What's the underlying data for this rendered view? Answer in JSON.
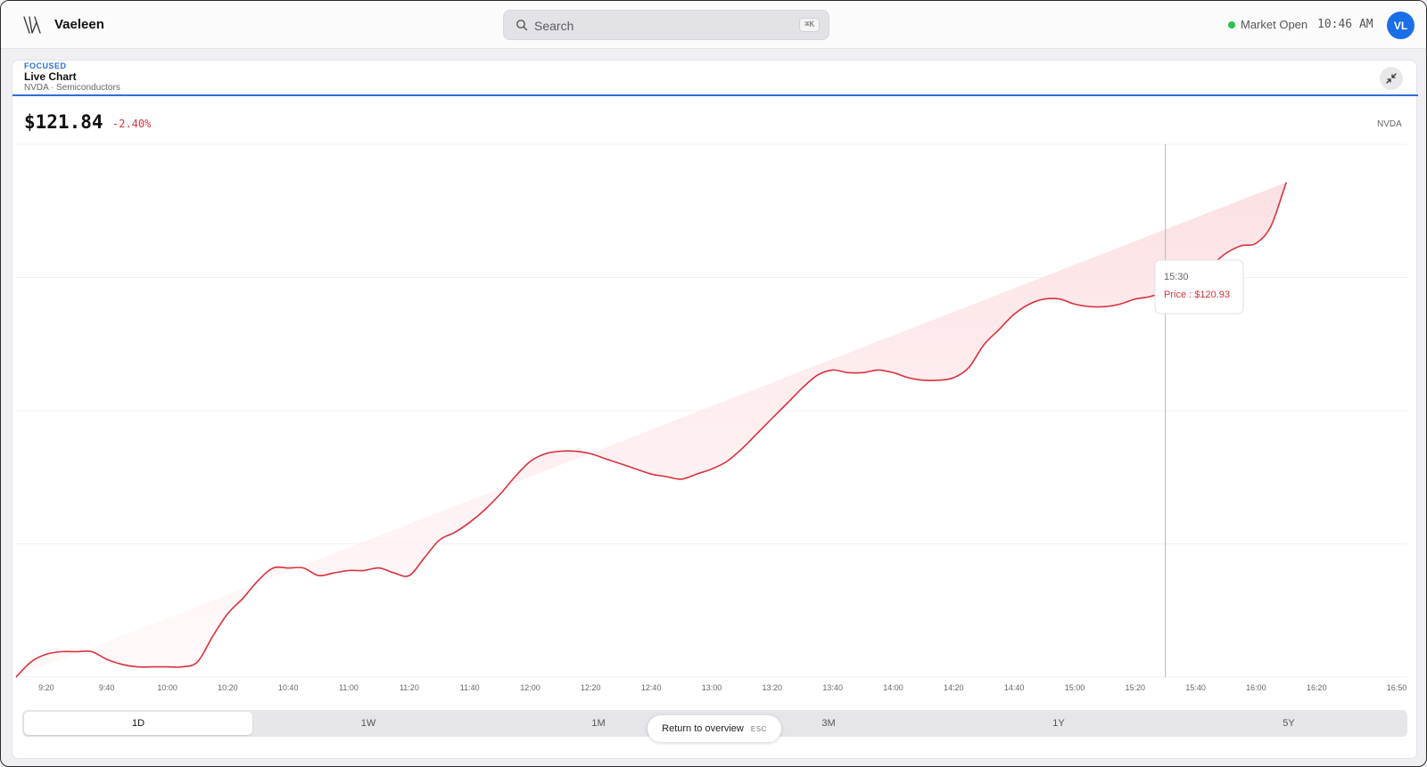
{
  "app": {
    "brand": "Vaeleen",
    "search_placeholder": "Search",
    "search_shortcut": "⌘K",
    "market_status": "Market Open",
    "time": "10:46 AM",
    "user_initials": "VL",
    "colors": {
      "accent": "#2f6fd6",
      "down": "#d8323d",
      "market_open": "#2ac24a",
      "avatar": "#1a6fe8"
    }
  },
  "card": {
    "badge": "FOCUSED",
    "title": "Live Chart",
    "subtitle": "NVDA · Semiconductors",
    "price": "$121.84",
    "change": "-2.40%",
    "ticker": "NVDA"
  },
  "tooltip": {
    "time": "15:30",
    "label": "Price : $120.93"
  },
  "ranges": [
    {
      "label": "1D",
      "active": true
    },
    {
      "label": "1W",
      "active": false
    },
    {
      "label": "1M",
      "active": false
    },
    {
      "label": "3M",
      "active": false
    },
    {
      "label": "1Y",
      "active": false
    },
    {
      "label": "5Y",
      "active": false
    }
  ],
  "return_overview": {
    "label": "Return to overview",
    "key": "ESC"
  },
  "chart_data": {
    "type": "area",
    "x": [
      "9:10",
      "9:15",
      "9:20",
      "9:25",
      "9:30",
      "9:35",
      "9:40",
      "9:45",
      "9:50",
      "9:55",
      "10:00",
      "10:05",
      "10:10",
      "10:15",
      "10:20",
      "10:25",
      "10:30",
      "10:35",
      "10:40",
      "10:45",
      "10:50",
      "10:55",
      "11:00",
      "11:05",
      "11:10",
      "11:15",
      "11:20",
      "11:25",
      "11:30",
      "11:35",
      "11:40",
      "11:45",
      "11:50",
      "11:55",
      "12:00",
      "12:05",
      "12:10",
      "12:15",
      "12:20",
      "12:25",
      "12:30",
      "12:35",
      "12:40",
      "12:45",
      "12:50",
      "12:55",
      "13:00",
      "13:05",
      "13:10",
      "13:15",
      "13:20",
      "13:25",
      "13:30",
      "13:35",
      "13:40",
      "13:45",
      "13:50",
      "13:55",
      "14:00",
      "14:05",
      "14:10",
      "14:15",
      "14:20",
      "14:25",
      "14:30",
      "14:35",
      "14:40",
      "14:45",
      "14:50",
      "14:55",
      "15:00",
      "15:05",
      "15:10",
      "15:15",
      "15:20",
      "15:25",
      "15:30",
      "15:35",
      "15:40",
      "15:45",
      "15:50",
      "15:55",
      "16:00",
      "16:05",
      "16:10",
      "16:15",
      "16:20",
      "16:25",
      "16:30",
      "16:35",
      "16:40",
      "16:45",
      "16:50"
    ],
    "values": [
      106.3,
      106.9,
      107.2,
      107.3,
      107.3,
      107.3,
      107.0,
      106.8,
      106.7,
      106.7,
      106.7,
      106.7,
      106.9,
      107.9,
      108.8,
      109.4,
      110.1,
      110.6,
      110.6,
      110.6,
      110.3,
      110.4,
      110.5,
      110.5,
      110.6,
      110.4,
      110.3,
      111.0,
      111.7,
      112.0,
      112.4,
      112.9,
      113.5,
      114.2,
      114.8,
      115.1,
      115.2,
      115.2,
      115.1,
      114.9,
      114.7,
      114.5,
      114.3,
      114.2,
      114.1,
      114.3,
      114.5,
      114.8,
      115.3,
      115.9,
      116.5,
      117.1,
      117.7,
      118.2,
      118.4,
      118.3,
      118.3,
      118.4,
      118.3,
      118.1,
      118.0,
      118.0,
      118.1,
      118.5,
      119.4,
      120.0,
      120.6,
      121.0,
      121.2,
      121.2,
      121.0,
      120.9,
      120.9,
      121.0,
      121.2,
      121.3,
      121.5,
      121.7,
      122.0,
      122.5,
      123.0,
      123.3,
      123.4,
      124.1,
      125.8,
      127.3
    ],
    "x_ticks": [
      "9:20",
      "9:40",
      "10:00",
      "10:20",
      "10:40",
      "11:00",
      "11:20",
      "11:40",
      "12:00",
      "12:20",
      "12:40",
      "13:00",
      "13:20",
      "13:40",
      "14:00",
      "14:20",
      "14:40",
      "15:00",
      "15:20",
      "15:40",
      "16:00",
      "16:20",
      "16:50"
    ],
    "ylim": [
      106.3,
      127.3
    ],
    "grid": true,
    "hover_x": "15:30",
    "hover_value": 120.93,
    "line_color": "#d8323d",
    "fill_color": "#fde8ea"
  }
}
